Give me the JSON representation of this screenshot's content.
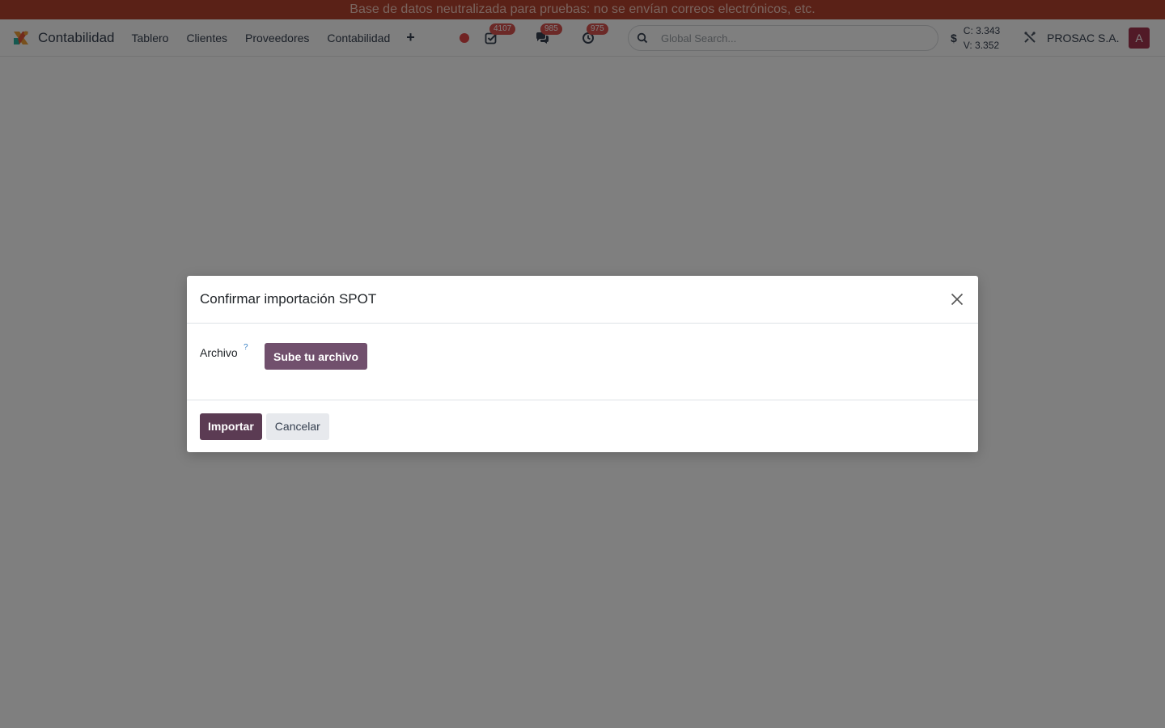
{
  "banner": {
    "text": "Base de datos neutralizada para pruebas: no se envían correos electrónicos, etc."
  },
  "navbar": {
    "app_name": "Contabilidad",
    "menu": [
      "Tablero",
      "Clientes",
      "Proveedores",
      "Contabilidad"
    ],
    "plus_label": "+",
    "badges": {
      "activities": "4107",
      "messages": "985",
      "clock": "975"
    },
    "search_placeholder": "Global Search...",
    "currency_symbol": "$",
    "rate_buy": "C: 3.343",
    "rate_sell": "V: 3.352",
    "company": "PROSAC S.A.",
    "avatar_letter": "A"
  },
  "modal": {
    "title": "Confirmar importación SPOT",
    "field_label": "Archivo",
    "help_mark": "?",
    "upload_label": "Sube tu archivo",
    "import_label": "Importar",
    "cancel_label": "Cancelar"
  },
  "colors": {
    "banner_bg": "#b5432f",
    "primary": "#5b3b53",
    "upload": "#71506d",
    "badge": "#d9534f",
    "avatar": "#a2354e"
  }
}
